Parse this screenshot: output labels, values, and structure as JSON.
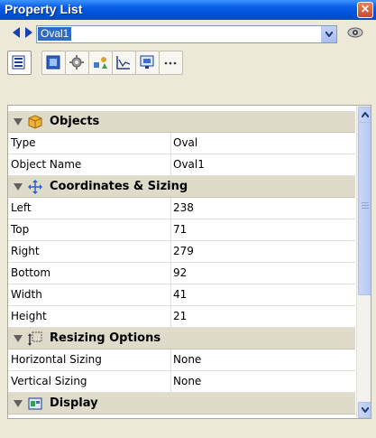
{
  "window": {
    "title": "Property List"
  },
  "selector": {
    "value": "Oval1"
  },
  "toolbar": {
    "buttons": [
      {
        "icon": "property-list-icon"
      },
      {
        "icon": "object-icon"
      },
      {
        "icon": "gear-icon"
      },
      {
        "icon": "shapes-icon"
      },
      {
        "icon": "chart-icon"
      },
      {
        "icon": "display-icon"
      },
      {
        "icon": "more-icon"
      }
    ]
  },
  "categories": {
    "objects": {
      "label": "Objects",
      "rows": [
        {
          "name": "Type",
          "value": "Oval"
        },
        {
          "name": "Object Name",
          "value": "Oval1"
        }
      ]
    },
    "coordinates": {
      "label": "Coordinates & Sizing",
      "rows": [
        {
          "name": "Left",
          "value": "238"
        },
        {
          "name": "Top",
          "value": "71"
        },
        {
          "name": "Right",
          "value": "279"
        },
        {
          "name": "Bottom",
          "value": "92"
        },
        {
          "name": "Width",
          "value": "41"
        },
        {
          "name": "Height",
          "value": "21"
        }
      ]
    },
    "resizing": {
      "label": "Resizing Options",
      "rows": [
        {
          "name": "Horizontal Sizing",
          "value": "None"
        },
        {
          "name": "Vertical Sizing",
          "value": "None"
        }
      ]
    },
    "display": {
      "label": "Display"
    }
  },
  "colors": {
    "titlebar": "#0a5fe8",
    "category_band": "#dedbcb",
    "selection": "#316ac5"
  }
}
